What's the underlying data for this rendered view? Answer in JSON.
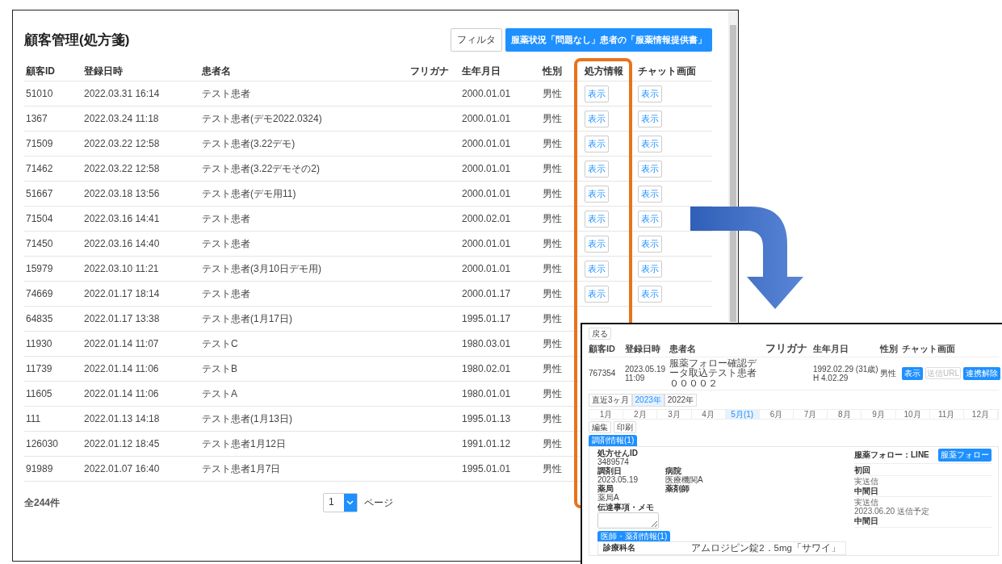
{
  "main": {
    "title": "顧客管理(処方箋)",
    "buttons": [
      {
        "label": "フィルタ",
        "kind": "outline"
      },
      {
        "label": "服薬状況「問題なし」患者の「服薬情報提供書」",
        "kind": "primary"
      }
    ],
    "columns": [
      "顧客ID",
      "登録日時",
      "患者名",
      "フリガナ",
      "生年月日",
      "性別",
      "処方情報",
      "チャット画面"
    ],
    "rows": [
      {
        "id": "51010",
        "registered": "2022.03.31 16:14",
        "name": "テスト患者",
        "birth": "2000.01.01",
        "sex": "男性",
        "prescription": "表示",
        "chat": "表示"
      },
      {
        "id": "1367",
        "registered": "2022.03.24 11:18",
        "name": "テスト患者(デモ2022.0324)",
        "birth": "2000.01.01",
        "sex": "男性",
        "prescription": "表示",
        "chat": "表示"
      },
      {
        "id": "71509",
        "registered": "2022.03.22 12:58",
        "name": "テスト患者(3.22デモ)",
        "birth": "2000.01.01",
        "sex": "男性",
        "prescription": "表示",
        "chat": "表示"
      },
      {
        "id": "71462",
        "registered": "2022.03.22 12:58",
        "name": "テスト患者(3.22デモその2)",
        "birth": "2000.01.01",
        "sex": "男性",
        "prescription": "表示",
        "chat": "表示"
      },
      {
        "id": "51667",
        "registered": "2022.03.18 13:56",
        "name": "テスト患者(デモ用11)",
        "birth": "2000.01.01",
        "sex": "男性",
        "prescription": "表示",
        "chat": "表示"
      },
      {
        "id": "71504",
        "registered": "2022.03.16 14:41",
        "name": "テスト患者",
        "birth": "2000.02.01",
        "sex": "男性",
        "prescription": "表示",
        "chat": "表示"
      },
      {
        "id": "71450",
        "registered": "2022.03.16 14:40",
        "name": "テスト患者",
        "birth": "2000.01.01",
        "sex": "男性",
        "prescription": "表示",
        "chat": "表示"
      },
      {
        "id": "15979",
        "registered": "2022.03.10 11:21",
        "name": "テスト患者(3月10日デモ用)",
        "birth": "2000.01.01",
        "sex": "男性",
        "prescription": "表示",
        "chat": "表示"
      },
      {
        "id": "74669",
        "registered": "2022.01.17 18:14",
        "name": "テスト患者",
        "birth": "2000.01.17",
        "sex": "男性",
        "prescription": "表示",
        "chat": "表示"
      },
      {
        "id": "64835",
        "registered": "2022.01.17 13:38",
        "name": "テスト患者(1月17日)",
        "birth": "1995.01.17",
        "sex": "男性"
      },
      {
        "id": "11930",
        "registered": "2022.01.14 11:07",
        "name": "テストC",
        "birth": "1980.03.01",
        "sex": "男性"
      },
      {
        "id": "11739",
        "registered": "2022.01.14 11:06",
        "name": "テストB",
        "birth": "1980.02.01",
        "sex": "男性"
      },
      {
        "id": "11605",
        "registered": "2022.01.14 11:06",
        "name": "テストA",
        "birth": "1980.01.01",
        "sex": "男性"
      },
      {
        "id": "111",
        "registered": "2022.01.13 14:18",
        "name": "テスト患者(1月13日)",
        "birth": "1995.01.13",
        "sex": "男性"
      },
      {
        "id": "126030",
        "registered": "2022.01.12 18:45",
        "name": "テスト患者1月12日",
        "birth": "1991.01.12",
        "sex": "男性"
      },
      {
        "id": "91989",
        "registered": "2022.01.07 16:40",
        "name": "テスト患者1月7日",
        "birth": "1995.01.01",
        "sex": "男性"
      }
    ],
    "total": "全244件",
    "page": {
      "value": "1",
      "label": "ページ"
    }
  },
  "detail": {
    "back": "戻る",
    "columns": [
      "顧客ID",
      "登録日時",
      "患者名",
      "フリガナ",
      "生年月日",
      "性別",
      "チャット画面"
    ],
    "patient": {
      "id": "767354",
      "registered": "2023.05.19 11:09",
      "name": "服薬フォロー確認データ取込テスト患者００００２",
      "birth": "1992.02.29 (31歳)",
      "birth_wareki": "H 4.02.29",
      "sex": "男性",
      "chat": "表示",
      "url_button": {
        "label": "送信URL",
        "disabled": true
      },
      "unlink": "連携解除"
    },
    "periods": [
      {
        "label": "直近3ヶ月",
        "selected": false
      },
      {
        "label": "2023年",
        "selected": true
      },
      {
        "label": "2022年",
        "selected": false
      }
    ],
    "months": [
      {
        "label": "1月",
        "selected": false
      },
      {
        "label": "2月",
        "selected": false
      },
      {
        "label": "3月",
        "selected": false
      },
      {
        "label": "4月",
        "selected": false
      },
      {
        "label": "5月(1)",
        "selected": true
      },
      {
        "label": "6月",
        "selected": false
      },
      {
        "label": "7月",
        "selected": false
      },
      {
        "label": "8月",
        "selected": false
      },
      {
        "label": "9月",
        "selected": false
      },
      {
        "label": "10月",
        "selected": false
      },
      {
        "label": "11月",
        "selected": false
      },
      {
        "label": "12月",
        "selected": false
      }
    ],
    "actions": [
      "編集",
      "印刷"
    ],
    "tab": "調剤情報(1)",
    "fields": [
      {
        "label": "処方せんID",
        "value": "3489574"
      },
      {
        "label": "調剤日",
        "value": "2023.05.19"
      },
      {
        "label": "病院",
        "value": "医療機関A"
      },
      {
        "label": "薬局",
        "value": "薬局A"
      },
      {
        "label": "薬剤師"
      }
    ],
    "memo_label": "伝達事項・メモ",
    "drug_tab": "医師・薬剤情報(1)",
    "drug": {
      "label": "診療科名",
      "value": "アムロジピン錠2．5mg「サワイ」"
    },
    "follow": {
      "title": "服薬フォロー：LINE",
      "button": "服薬フォロー",
      "sections": [
        {
          "heading": "初回",
          "lines": [
            "実送信"
          ]
        },
        {
          "heading": "中間日",
          "lines": [
            "実送信",
            "2023.06.20 送信予定"
          ]
        },
        {
          "heading": "中間日"
        }
      ]
    }
  }
}
